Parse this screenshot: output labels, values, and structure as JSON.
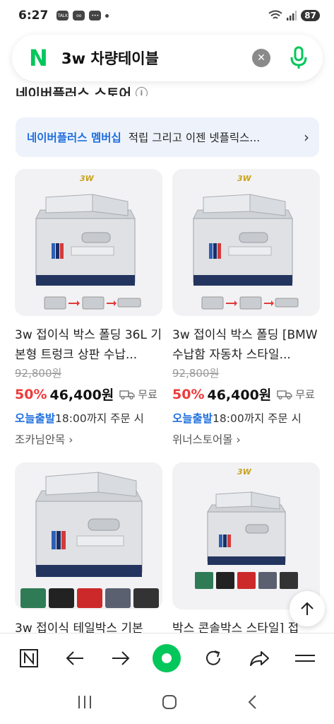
{
  "status_bar": {
    "time": "6:27",
    "battery": "87"
  },
  "search": {
    "query": "3w 차량테이블"
  },
  "section": {
    "title": "네이버플러스 스토어"
  },
  "membership": {
    "brand": "네이버플러스 멤버십",
    "text": "적립 그리고 이젠 넷플릭스..."
  },
  "products": [
    {
      "title": "3w 접이식 박스 폴딩 36L 기본형 트렁크 상판 수납...",
      "original_price": "92,800원",
      "discount": "50%",
      "price": "46,400원",
      "shipping": "무료",
      "delivery_today": "오늘출발",
      "delivery_rest": "18:00까지 주문 시",
      "store": "조카님안목",
      "thumb_brand": "3W"
    },
    {
      "title": "3w 접이식 박스 폴딩 [BMW 수납함 자동차 스타일...",
      "original_price": "92,800원",
      "discount": "50%",
      "price": "46,400원",
      "shipping": "무료",
      "delivery_today": "오늘출발",
      "delivery_rest": "18:00까지 주문 시",
      "store": "위너스토어몰",
      "thumb_brand": "3W"
    },
    {
      "title": "3w 접이식 테일박스 기본",
      "thumb_brand": ""
    },
    {
      "title": "박스 콘솔박스 스타일] 접",
      "thumb_brand": "3W"
    }
  ]
}
